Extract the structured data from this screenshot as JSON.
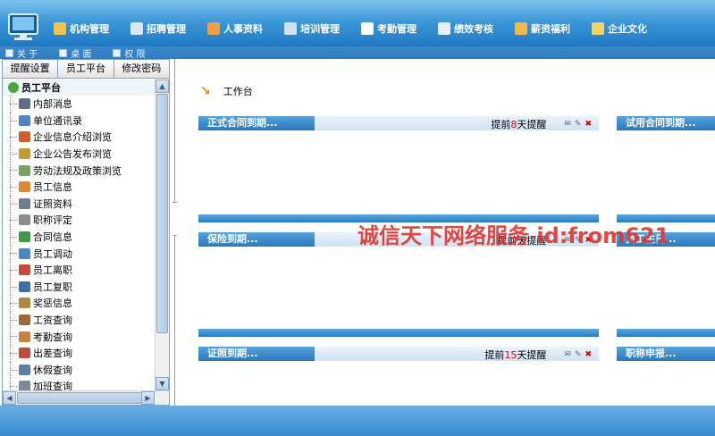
{
  "topnav": [
    {
      "label": "机构管理",
      "icon": "org-icon",
      "color": "#f2c14e"
    },
    {
      "label": "招聘管理",
      "icon": "recruit-icon",
      "color": "#d9e6f5"
    },
    {
      "label": "人事资料",
      "icon": "people-icon",
      "color": "#f0a040"
    },
    {
      "label": "培训管理",
      "icon": "training-icon",
      "color": "#cfe1f2"
    },
    {
      "label": "考勤管理",
      "icon": "attendance-icon",
      "color": "#ffffff"
    },
    {
      "label": "绩效考核",
      "icon": "performance-icon",
      "color": "#e8eef5"
    },
    {
      "label": "薪资福利",
      "icon": "salary-icon",
      "color": "#f3b84a"
    },
    {
      "label": "企业文化",
      "icon": "culture-icon",
      "color": "#f2d36b"
    }
  ],
  "subnav": [
    {
      "label": "关 于"
    },
    {
      "label": "桌 面"
    },
    {
      "label": "权 限"
    }
  ],
  "left_tabs": [
    "提醒设置",
    "员工平台",
    "修改密码"
  ],
  "tree": {
    "root": "员工平台",
    "items": [
      {
        "label": "内部消息",
        "color": "#5b6f84"
      },
      {
        "label": "单位通讯录",
        "color": "#4a86c5"
      },
      {
        "label": "企业信息介绍浏览",
        "color": "#d45a2a"
      },
      {
        "label": "企业公告发布浏览",
        "color": "#c79a2d"
      },
      {
        "label": "劳动法规及政策浏览",
        "color": "#7aa06a"
      },
      {
        "label": "员工信息",
        "color": "#e28a2b"
      },
      {
        "label": "证照资料",
        "color": "#6d7e8f"
      },
      {
        "label": "职称评定",
        "color": "#8c8c8c"
      },
      {
        "label": "合同信息",
        "color": "#3f9a44"
      },
      {
        "label": "员工调动",
        "color": "#4a86c5"
      },
      {
        "label": "员工离职",
        "color": "#c9473b"
      },
      {
        "label": "员工复职",
        "color": "#3e6ea8"
      },
      {
        "label": "奖惩信息",
        "color": "#b08a3c"
      },
      {
        "label": "工资查询",
        "color": "#9a6a3a"
      },
      {
        "label": "考勤查询",
        "color": "#c7823b"
      },
      {
        "label": "出差查询",
        "color": "#c24a3a"
      },
      {
        "label": "休假查询",
        "color": "#5a7fa8"
      },
      {
        "label": "加班查询",
        "color": "#7a8a9a"
      }
    ]
  },
  "breadcrumb": "工作台",
  "panels": [
    {
      "title": "正式合同到期...",
      "remind_prefix": "提前",
      "remind_num": "8",
      "remind_suffix": "天提醒"
    },
    {
      "title": "试用合同到期...",
      "remind_prefix": "",
      "remind_num": "",
      "remind_suffix": ""
    },
    {
      "title": "保险到期...",
      "remind_prefix": "提前",
      "remind_num": "",
      "remind_suffix": "天提醒"
    },
    {
      "title": "员工生日...",
      "remind_prefix": "",
      "remind_num": "",
      "remind_suffix": ""
    },
    {
      "title": "证照到期...",
      "remind_prefix": "提前",
      "remind_num": "15",
      "remind_suffix": "天提醒"
    },
    {
      "title": "职称申报...",
      "remind_prefix": "",
      "remind_num": "",
      "remind_suffix": ""
    }
  ],
  "watermark": "诚信天下网络服务 id:from621",
  "colors": {
    "accent": "#2a78bd",
    "remind_num": "#e00000"
  }
}
